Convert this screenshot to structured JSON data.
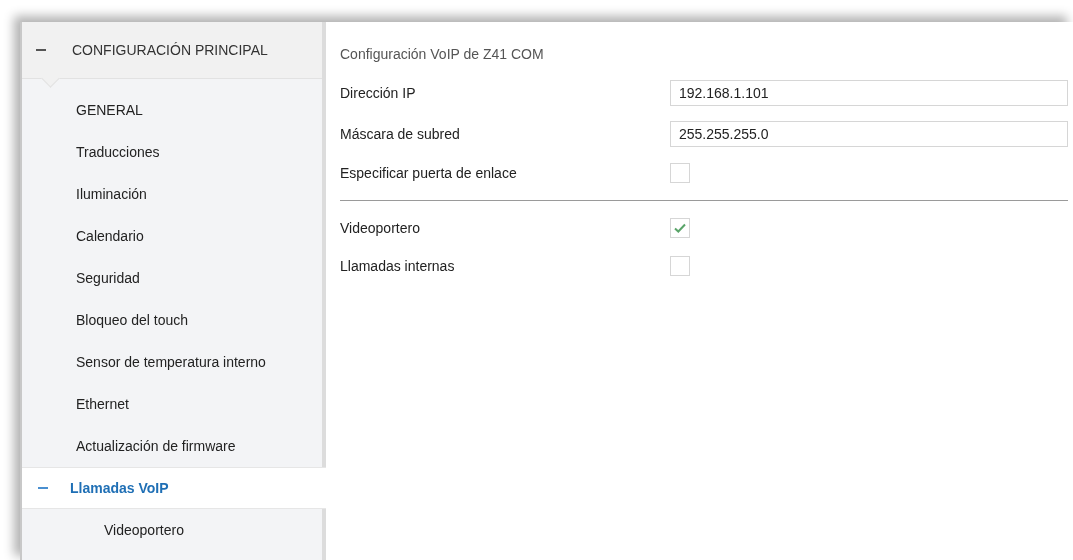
{
  "sidebar": {
    "header": {
      "label": "CONFIGURACIÓN PRINCIPAL",
      "expanded": true
    },
    "items": [
      {
        "label": "GENERAL",
        "selected": false
      },
      {
        "label": "Traducciones",
        "selected": false
      },
      {
        "label": "Iluminación",
        "selected": false
      },
      {
        "label": "Calendario",
        "selected": false
      },
      {
        "label": "Seguridad",
        "selected": false
      },
      {
        "label": "Bloqueo del touch",
        "selected": false
      },
      {
        "label": "Sensor de temperatura interno",
        "selected": false
      },
      {
        "label": "Ethernet",
        "selected": false
      },
      {
        "label": "Actualización de firmware",
        "selected": false
      },
      {
        "label": "Llamadas VoIP",
        "selected": true,
        "expanded": true,
        "children": [
          {
            "label": "Videoportero",
            "selected": false
          }
        ]
      }
    ]
  },
  "panel": {
    "title": "Configuración VoIP de Z41 COM",
    "rows": [
      {
        "kind": "field",
        "label": "Dirección IP",
        "value": "192.168.1.101"
      },
      {
        "kind": "field",
        "label": "Máscara de subred",
        "value": "255.255.255.0"
      },
      {
        "kind": "checkbox",
        "label": "Especificar puerta de enlace",
        "checked": false
      },
      {
        "kind": "divider"
      },
      {
        "kind": "checkbox",
        "label": "Videoportero",
        "checked": true
      },
      {
        "kind": "checkbox",
        "label": "Llamadas internas",
        "checked": false
      }
    ]
  }
}
